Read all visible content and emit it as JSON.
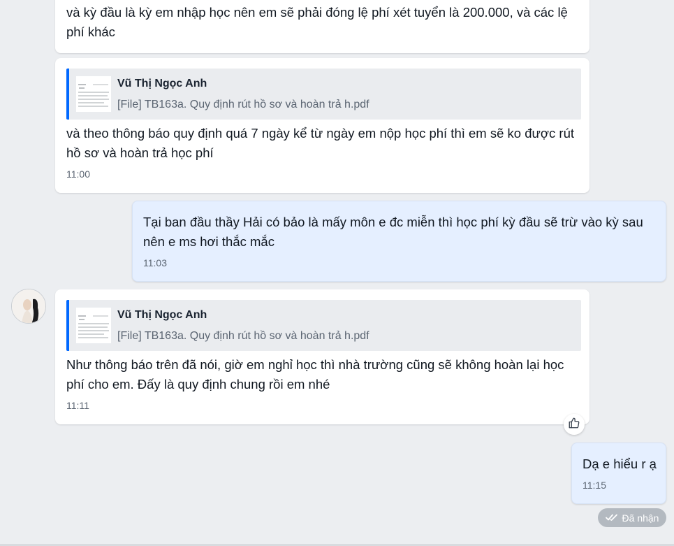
{
  "messages": [
    {
      "text": "và kỳ đầu là kỳ em nhập học nên em sẽ phải đóng lệ phí xét tuyển là 200.000, và các lệ phí khác"
    },
    {
      "quote": {
        "name": "Vũ Thị Ngọc Anh",
        "file": "[File] TB163a. Quy định rút hồ sơ và hoàn trả h.pdf"
      },
      "text": "và theo thông báo quy định quá 7 ngày kể từ ngày em nộp học phí thì em sẽ ko được rút hồ sơ và hoàn trả học phí",
      "time": "11:00"
    },
    {
      "text": "Tại ban đầu thầy Hải có bảo là mấy môn e đc miễn thì học phí kỳ đầu sẽ trừ vào kỳ sau nên e ms hơi thắc mắc",
      "time": "11:03"
    },
    {
      "quote": {
        "name": "Vũ Thị Ngọc Anh",
        "file": "[File] TB163a. Quy định rút hồ sơ và hoàn trả h.pdf"
      },
      "text": "Như thông báo trên đã nói, giờ em nghỉ học thì nhà trường cũng sẽ không hoàn lại học phí cho em. Đấy là quy định chung rồi em nhé",
      "time": "11:11"
    },
    {
      "text": "Dạ e hiểu r ạ",
      "time": "11:15"
    }
  ],
  "status": {
    "icon": "double-check-icon",
    "label": "Đã nhận"
  },
  "reaction": {
    "icon": "thumbs-up-icon"
  },
  "colors": {
    "background": "#eceef1",
    "incoming_bubble": "#ffffff",
    "outgoing_bubble": "#e5efff",
    "quote_bar": "#0068ff",
    "status_badge": "#b3b9c0"
  }
}
